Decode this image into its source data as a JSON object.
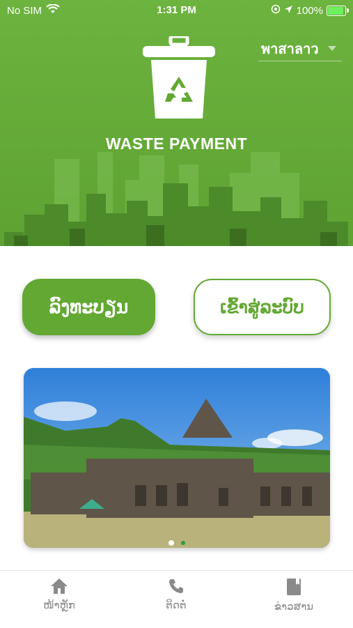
{
  "status_bar": {
    "carrier": "No SIM",
    "time": "1:31 PM",
    "battery": "100%",
    "battery_level": 1.0
  },
  "header": {
    "language": "พาสาลาว",
    "app_title": "WASTE PAYMENT",
    "colors": {
      "primary": "#62a832",
      "header_bg": "#6db33f",
      "skyline": "#3f7a22"
    }
  },
  "actions": {
    "register_label": "ລົງທະບຽນ",
    "login_label": "ເຂົ້າສູ່ລະບົບ"
  },
  "carousel": {
    "slide_count": 2,
    "active_index": 0
  },
  "tabs": [
    {
      "label": "ໜ້າຫຼັກ",
      "icon": "home-icon"
    },
    {
      "label": "ຕິດຕໍ່",
      "icon": "phone-icon"
    },
    {
      "label": "ຂ່າວສານ",
      "icon": "book-icon"
    }
  ]
}
